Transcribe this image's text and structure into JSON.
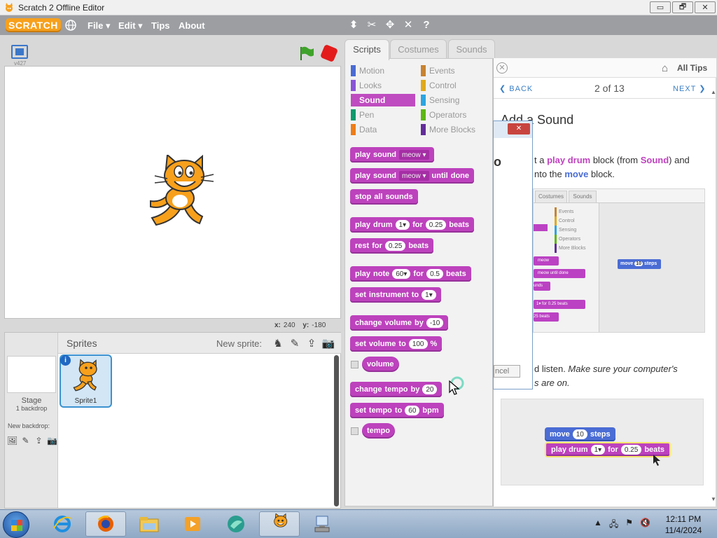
{
  "window": {
    "title": "Scratch 2 Offline Editor",
    "controls": [
      "▭",
      "🗗",
      "✕"
    ]
  },
  "menubar": {
    "logo": "SCRATCH",
    "file": "File ▾",
    "edit": "Edit ▾",
    "tips": "Tips",
    "about": "About"
  },
  "stage": {
    "version": "v427",
    "x_label": "x:",
    "x_value": "240",
    "y_label": "y:",
    "y_value": "-180"
  },
  "sprites": {
    "title": "Sprites",
    "new_sprite": "New sprite:",
    "stage_label": "Stage",
    "stage_sub": "1 backdrop",
    "new_backdrop": "New backdrop:",
    "sprite1": "Sprite1"
  },
  "tabs": [
    "Scripts",
    "Costumes",
    "Sounds"
  ],
  "categories": {
    "left": [
      "Motion",
      "Looks",
      "Sound",
      "Pen",
      "Data"
    ],
    "right": [
      "Events",
      "Control",
      "Sensing",
      "Operators",
      "More Blocks"
    ],
    "colors": {
      "Motion": "#4a6cd4",
      "Looks": "#8a55d7",
      "Sound": "#bb42c3",
      "Pen": "#0e9a6c",
      "Data": "#ee7d16",
      "Events": "#c88330",
      "Control": "#e1a91a",
      "Sensing": "#2ca5e2",
      "Operators": "#5cb712",
      "More Blocks": "#632d99"
    }
  },
  "blocks": {
    "b1": {
      "a": "play",
      "b": "sound",
      "dd": "meow"
    },
    "b2": {
      "a": "play",
      "b": "sound",
      "dd": "meow",
      "c": "until",
      "d": "done"
    },
    "b3": {
      "a": "stop",
      "b": "all",
      "c": "sounds"
    },
    "b4": {
      "a": "play",
      "b": "drum",
      "v1": "1▾",
      "c": "for",
      "v2": "0.25",
      "d": "beats"
    },
    "b5": {
      "a": "rest",
      "b": "for",
      "v1": "0.25",
      "c": "beats"
    },
    "b6": {
      "a": "play",
      "b": "note",
      "v1": "60▾",
      "c": "for",
      "v2": "0.5",
      "d": "beats"
    },
    "b7": {
      "a": "set",
      "b": "instrument",
      "c": "to",
      "v1": "1▾"
    },
    "b8": {
      "a": "change",
      "b": "volume",
      "c": "by",
      "v1": "-10"
    },
    "b9": {
      "a": "set",
      "b": "volume",
      "c": "to",
      "v1": "100",
      "d": "%"
    },
    "b10": {
      "a": "volume"
    },
    "b11": {
      "a": "change",
      "b": "tempo",
      "c": "by",
      "v1": "20"
    },
    "b12": {
      "a": "set",
      "b": "tempo",
      "c": "to",
      "v1": "60",
      "d": "bpm"
    },
    "b13": {
      "a": "tempo"
    }
  },
  "tips": {
    "all_tips": "All Tips",
    "back": "❮ BACK",
    "counter": "2 of 13",
    "next": "NEXT ❯",
    "title": "Add a Sound",
    "text_a": "t a ",
    "text_b": "play drum",
    "text_c": " block (from ",
    "text_d": "Sound",
    "text_e": ") and",
    "text_f": "nto the ",
    "text_g": "move",
    "text_h": " block.",
    "img_tabs": [
      "Costumes",
      "Sounds"
    ],
    "img_cats": [
      "Events",
      "Control",
      "Sensing",
      "Operators",
      "More Blocks"
    ],
    "img_blocks": [
      "meow",
      "meow",
      "until done",
      "unds",
      "for",
      "0.25",
      "beats",
      "25",
      "beats"
    ],
    "img_move": {
      "a": "move",
      "v": "10",
      "b": "steps"
    },
    "text2_a": "d listen. ",
    "text2_b": "Make sure your computer's",
    "text2_c": "s are on.",
    "demo_move": {
      "a": "move",
      "v": "10",
      "b": "steps"
    },
    "demo_drum": {
      "a": "play drum",
      "v1": "1▾",
      "b": "for",
      "v2": "0.25",
      "c": "beats"
    }
  },
  "dialog": {
    "close": "✕",
    "o": "o",
    "cancel": "ncel"
  },
  "taskbar": {
    "time": "12:11 PM",
    "date": "11/4/2024"
  }
}
